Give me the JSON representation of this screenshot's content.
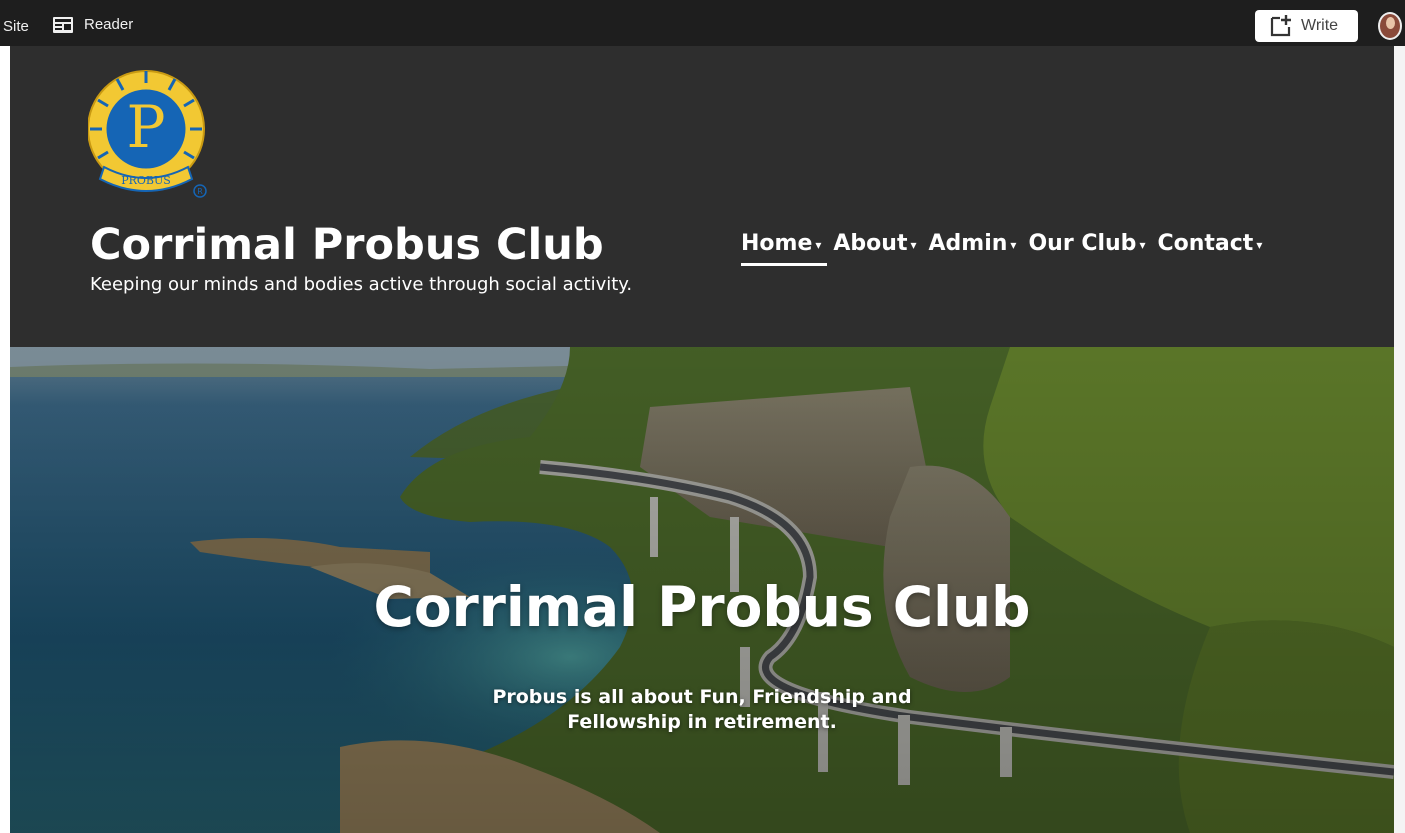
{
  "adminbar": {
    "site_label": "Site",
    "reader_label": "Reader",
    "write_label": "Write"
  },
  "header": {
    "logo_text": "PROBUS",
    "title": "Corrimal Probus Club",
    "tagline": "Keeping our minds and bodies active through social activity."
  },
  "nav": {
    "items": [
      {
        "label": "Home",
        "caret": "▾"
      },
      {
        "label": "About",
        "caret": "▾"
      },
      {
        "label": "Admin",
        "caret": "▾"
      },
      {
        "label": "Our Club",
        "caret": "▾"
      },
      {
        "label": "Contact",
        "caret": "▾"
      }
    ]
  },
  "hero": {
    "title": "Corrimal Probus Club",
    "subtitle": "Probus is all about Fun, Friendship and Fellowship in retirement."
  },
  "colors": {
    "adminbar": "#1e1e1e",
    "header_bg": "#2e2e2e",
    "logo_blue": "#1565b5",
    "logo_gold": "#f2c833"
  }
}
